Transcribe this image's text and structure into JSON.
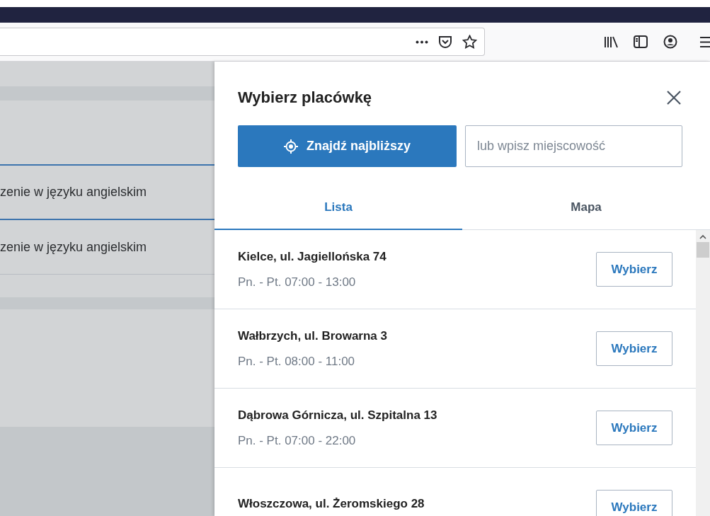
{
  "background_rows": [
    {
      "text": "zenie w języku angielskim"
    },
    {
      "text": "zenie w języku angielskim"
    }
  ],
  "drawer": {
    "title": "Wybierz placówkę",
    "locate_button": "Znajdź najbliższy",
    "search": {
      "placeholder": "lub wpisz miejscowość"
    },
    "tabs": [
      {
        "label": "Lista",
        "selected": true
      },
      {
        "label": "Mapa",
        "selected": false
      }
    ],
    "locations": [
      {
        "name": "Kielce, ul. Jagiellońska 74",
        "hours": "Pn. - Pt. 07:00 - 13:00",
        "button": "Wybierz"
      },
      {
        "name": "Wałbrzych, ul. Browarna 3",
        "hours": "Pn. - Pt. 08:00 - 11:00",
        "button": "Wybierz"
      },
      {
        "name": "Dąbrowa Górnicza, ul. Szpitalna 13",
        "hours": "Pn. - Pt. 07:00 - 22:00",
        "button": "Wybierz"
      },
      {
        "name": "Włoszczowa, ul. Żeromskiego 28",
        "button": "Wybierz"
      }
    ]
  }
}
